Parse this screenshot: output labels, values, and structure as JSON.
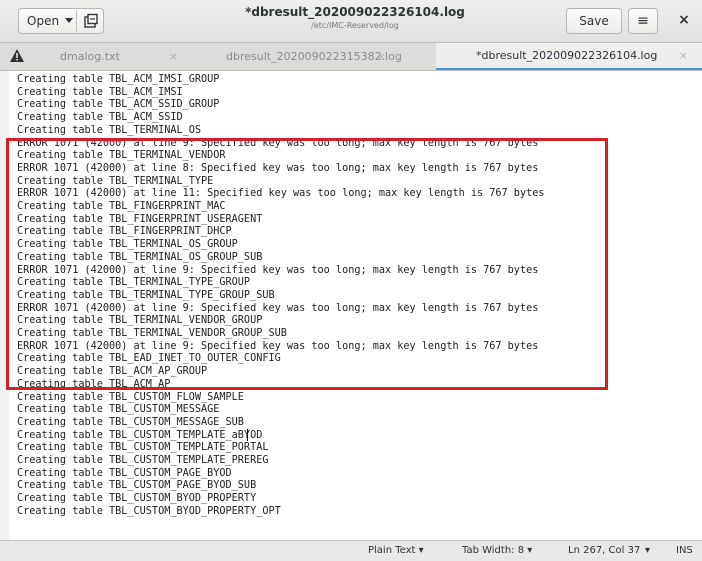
{
  "header": {
    "open_label": "Open",
    "title": "*dbresult_202009022326104.log",
    "subtitle": "/etc/IMC-Reserved/log",
    "save_label": "Save",
    "menu_glyph": "≡",
    "close_glyph": "×"
  },
  "tabs": [
    {
      "label": "dmalog.txt",
      "warning": true,
      "active": false
    },
    {
      "label": "dbresult_202009022315382.log",
      "warning": false,
      "active": false
    },
    {
      "label": "*dbresult_202009022326104.log",
      "warning": false,
      "active": true
    }
  ],
  "editor": {
    "lines": [
      "Creating table TBL_ACM_IMSI_GROUP",
      "Creating table TBL_ACM_IMSI",
      "Creating table TBL_ACM_SSID_GROUP",
      "Creating table TBL_ACM_SSID",
      "Creating table TBL_TERMINAL_OS",
      "ERROR 1071 (42000) at line 9: Specified key was too long; max key length is 767 bytes",
      "Creating table TBL_TERMINAL_VENDOR",
      "ERROR 1071 (42000) at line 8: Specified key was too long; max key length is 767 bytes",
      "Creating table TBL_TERMINAL_TYPE",
      "ERROR 1071 (42000) at line 11: Specified key was too long; max key length is 767 bytes",
      "Creating table TBL_FINGERPRINT_MAC",
      "Creating table TBL_FINGERPRINT_USERAGENT",
      "Creating table TBL_FINGERPRINT_DHCP",
      "Creating table TBL_TERMINAL_OS_GROUP",
      "Creating table TBL_TERMINAL_OS_GROUP_SUB",
      "ERROR 1071 (42000) at line 9: Specified key was too long; max key length is 767 bytes",
      "Creating table TBL_TERMINAL_TYPE_GROUP",
      "Creating table TBL_TERMINAL_TYPE_GROUP_SUB",
      "ERROR 1071 (42000) at line 9: Specified key was too long; max key length is 767 bytes",
      "Creating table TBL_TERMINAL_VENDOR_GROUP",
      "Creating table TBL_TERMINAL_VENDOR_GROUP_SUB",
      "ERROR 1071 (42000) at line 9: Specified key was too long; max key length is 767 bytes",
      "Creating table TBL_EAD_INET_TO_OUTER_CONFIG",
      "Creating table TBL_ACM_AP_GROUP",
      "Creating table TBL_ACM_AP",
      "Creating table TBL_CUSTOM_FLOW_SAMPLE",
      "Creating table TBL_CUSTOM_MESSAGE",
      "Creating table TBL_CUSTOM_MESSAGE_SUB",
      "Creating table TBL_CUSTOM_TEMPLATE_aBYOD",
      "Creating table TBL_CUSTOM_TEMPLATE_PORTAL",
      "Creating table TBL_CUSTOM_TEMPLATE_PREREG",
      "Creating table TBL_CUSTOM_PAGE_BYOD",
      "Creating table TBL_CUSTOM_PAGE_BYOD_SUB",
      "Creating table TBL_CUSTOM_BYOD_PROPERTY",
      "Creating table TBL_CUSTOM_BYOD_PROPERTY_OPT"
    ]
  },
  "status": {
    "syntax": "Plain Text",
    "tab_width": "Tab Width: 8",
    "position": "Ln 267, Col 37",
    "mode": "INS"
  },
  "colors": {
    "highlight_border": "#d4202a",
    "active_tab_underline": "#4a90d9"
  }
}
